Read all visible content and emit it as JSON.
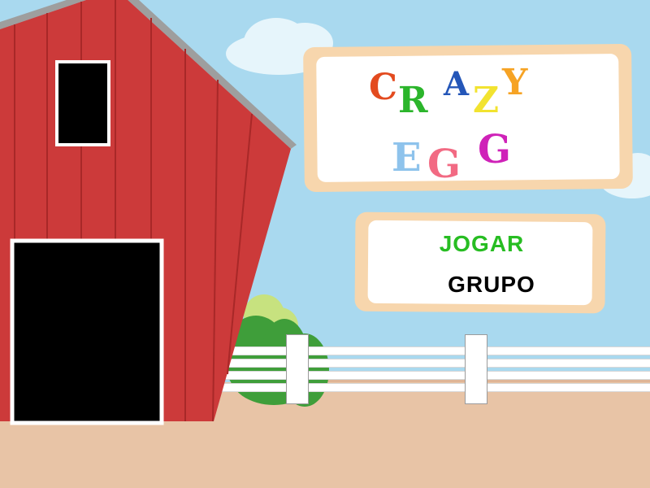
{
  "title": {
    "line1": [
      {
        "ch": "C",
        "color": "#e34b1f"
      },
      {
        "ch": "R",
        "color": "#2bb52b"
      },
      {
        "ch": "A",
        "color": "#2456b8"
      },
      {
        "ch": "Z",
        "color": "#f2e330"
      },
      {
        "ch": "Y",
        "color": "#f6a324"
      }
    ],
    "line2": [
      {
        "ch": "E",
        "color": "#8ec3ec"
      },
      {
        "ch": "G",
        "color": "#f26a83"
      },
      {
        "ch": "G",
        "color": "#cf22b8"
      }
    ]
  },
  "menu": {
    "play_label": "JOGAR",
    "play_color": "#27bd22",
    "group_label": "GRUPO",
    "group_color": "#000000"
  },
  "colors": {
    "sky": "#a9d9ef",
    "barn_red": "#cc3a3a",
    "board_frame": "#f7d6ad",
    "ground": "#e8c4a6"
  }
}
